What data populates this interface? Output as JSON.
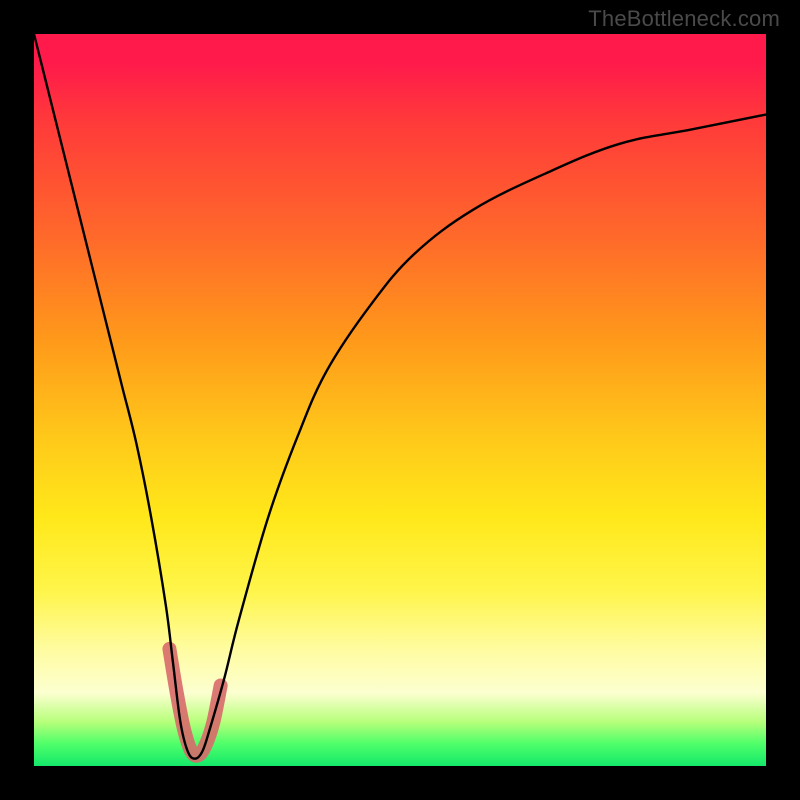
{
  "watermark": "TheBottleneck.com",
  "colors": {
    "frame": "#000000",
    "gradient_top": "#ff1a4b",
    "gradient_mid1": "#ff9a1a",
    "gradient_mid2": "#fff54a",
    "gradient_bottom": "#14e86a",
    "curve": "#000000",
    "marker": "#d86a6a"
  },
  "chart_data": {
    "type": "line",
    "title": "",
    "xlabel": "",
    "ylabel": "",
    "xlim": [
      0,
      100
    ],
    "ylim": [
      0,
      100
    ],
    "grid": false,
    "legend": false,
    "series": [
      {
        "name": "bottleneck-curve",
        "x": [
          0,
          2,
          4,
          6,
          8,
          10,
          12,
          14,
          16,
          18,
          19,
          20,
          21,
          22,
          23,
          24,
          26,
          28,
          32,
          36,
          40,
          46,
          52,
          60,
          70,
          80,
          90,
          100
        ],
        "y": [
          100,
          92,
          84,
          76,
          68,
          60,
          52,
          44,
          34,
          22,
          14,
          6,
          2,
          1,
          2,
          5,
          12,
          20,
          34,
          45,
          54,
          63,
          70,
          76,
          81,
          85,
          87,
          89
        ]
      }
    ],
    "highlight": {
      "name": "optimal-range",
      "x": [
        18.5,
        19.5,
        20.5,
        21.5,
        22.5,
        23.5,
        24.5,
        25.5
      ],
      "y": [
        16,
        10,
        5,
        2,
        1.5,
        3,
        6,
        11
      ]
    }
  }
}
